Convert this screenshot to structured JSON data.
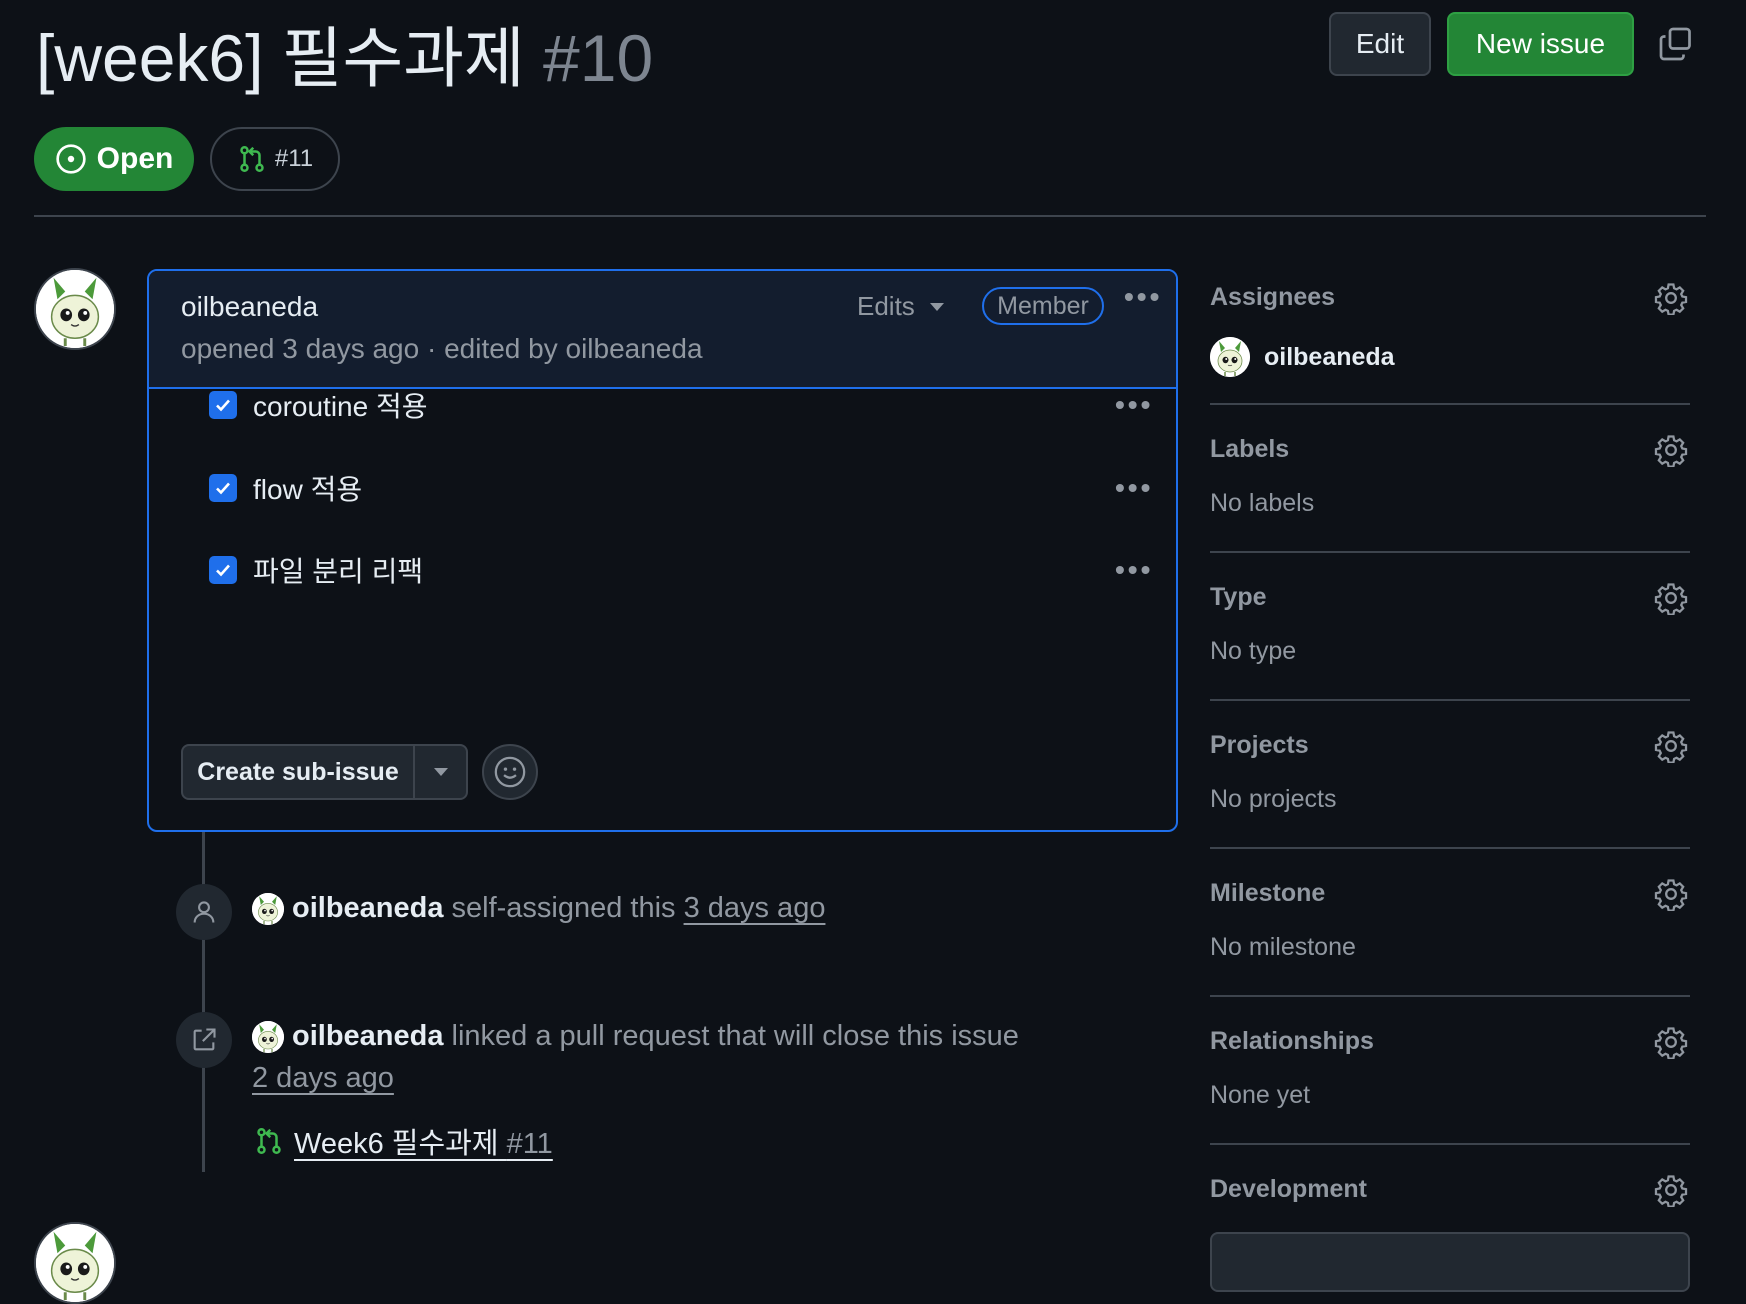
{
  "issue": {
    "title": "[week6] 필수과제",
    "number": "#10",
    "state": "Open",
    "linked_pr": "#11"
  },
  "header": {
    "edit_label": "Edit",
    "new_issue_label": "New issue"
  },
  "comment": {
    "author": "oilbeaneda",
    "meta": "opened 3 days ago · edited by oilbeaneda",
    "edits_label": "Edits",
    "role_badge": "Member",
    "tasks": [
      {
        "label": "coroutine 적용",
        "checked": true
      },
      {
        "label": "flow 적용",
        "checked": true
      },
      {
        "label": "파일 분리 리팩",
        "checked": true
      }
    ],
    "create_sub_issue_label": "Create sub-issue"
  },
  "timeline": {
    "event1": {
      "actor": "oilbeaneda",
      "text": "self-assigned this",
      "time": "3 days ago"
    },
    "event2": {
      "actor": "oilbeaneda",
      "text": "linked a pull request that will close this issue",
      "time": "2 days ago",
      "pr_title": "Week6 필수과제",
      "pr_number": "#11"
    }
  },
  "sidebar": {
    "assignees": {
      "title": "Assignees",
      "value": "oilbeaneda"
    },
    "labels": {
      "title": "Labels",
      "value": "No labels"
    },
    "type": {
      "title": "Type",
      "value": "No type"
    },
    "projects": {
      "title": "Projects",
      "value": "No projects"
    },
    "milestone": {
      "title": "Milestone",
      "value": "No milestone"
    },
    "relationships": {
      "title": "Relationships",
      "value": "None yet"
    },
    "development": {
      "title": "Development"
    }
  },
  "colors": {
    "background": "#0d1117",
    "open_green": "#238636",
    "accent_blue": "#1f6feb",
    "muted_text": "#9198a1"
  },
  "icons": [
    "copy-icon",
    "issue-open-icon",
    "pull-request-icon",
    "kebab-icon",
    "checkbox-checked-icon",
    "chevron-down-icon",
    "smiley-icon",
    "person-icon",
    "link-external-icon",
    "gear-icon"
  ]
}
